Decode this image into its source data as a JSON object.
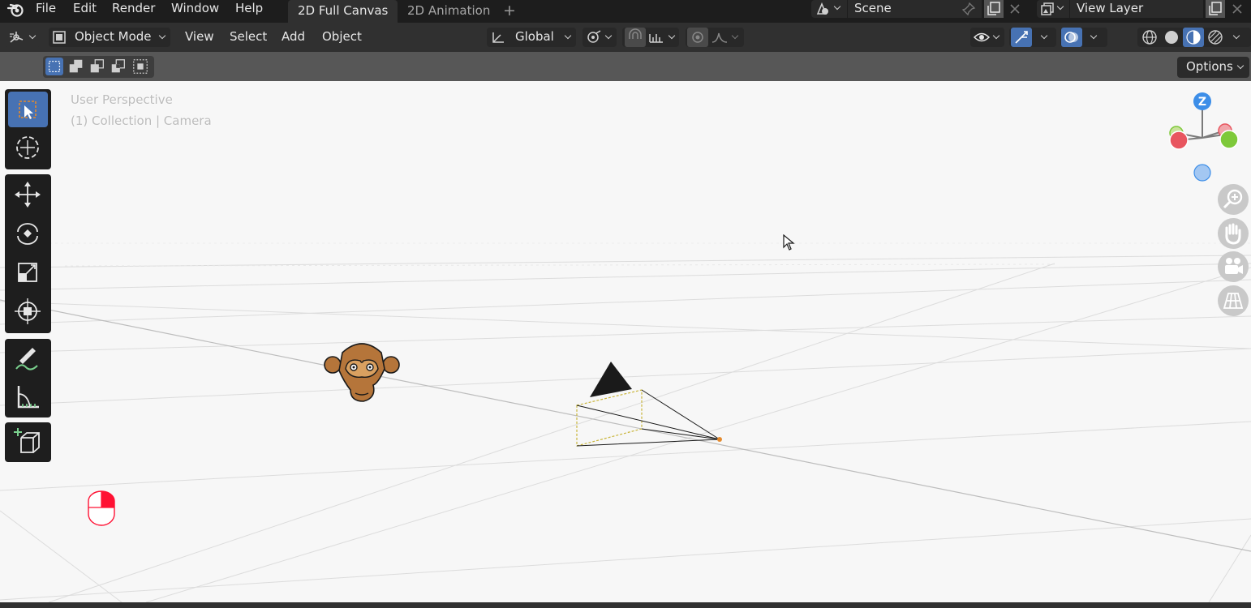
{
  "menubar": {
    "items": [
      "File",
      "Edit",
      "Render",
      "Window",
      "Help"
    ]
  },
  "workspaces": {
    "tabs": [
      "2D Full Canvas",
      "2D Animation"
    ],
    "add_symbol": "+"
  },
  "scene": {
    "name": "Scene"
  },
  "view_layer": {
    "name": "View Layer"
  },
  "header": {
    "mode": "Object Mode",
    "menus": [
      "View",
      "Select",
      "Add",
      "Object"
    ],
    "orientation": "Global"
  },
  "tool_header": {
    "options_label": "Options"
  },
  "viewport": {
    "overlay_line1": "User Perspective",
    "overlay_line2": "(1) Collection | Camera",
    "gizmo_axis_z": "Z"
  },
  "colors": {
    "accent": "#4772b3",
    "axis_x": "#e8555f",
    "axis_y": "#7ec93a",
    "axis_z": "#3d8ee8",
    "camera_frame": "#c9b53a",
    "mouse_indicator": "#ff1133"
  },
  "icons": {
    "app": "blender-logo-icon",
    "toolbar": [
      "select-box-icon",
      "cursor-icon",
      "move-icon",
      "rotate-icon",
      "scale-icon",
      "transform-icon",
      "annotate-icon",
      "measure-icon",
      "add-cube-icon"
    ],
    "nav": [
      "zoom-icon",
      "pan-hand-icon",
      "camera-view-icon",
      "ortho-grid-icon"
    ]
  }
}
